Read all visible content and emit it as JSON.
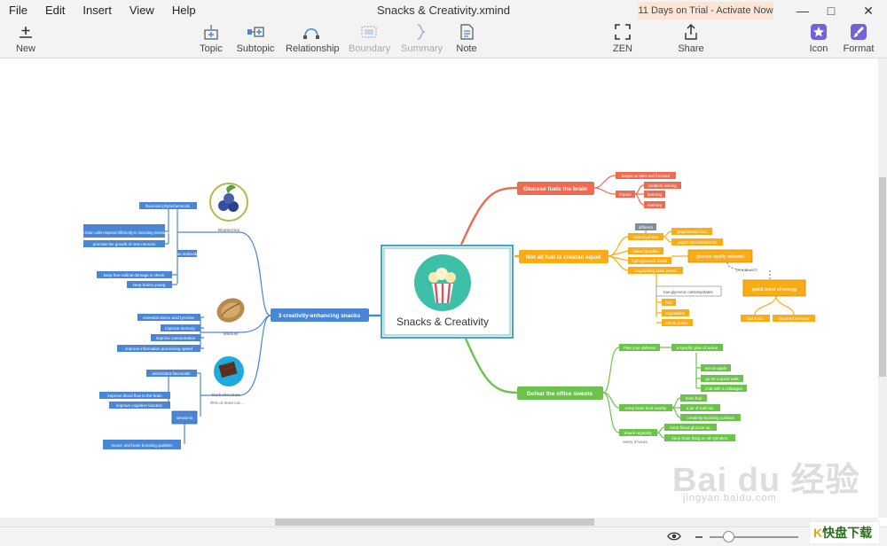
{
  "menu": [
    "File",
    "Edit",
    "Insert",
    "View",
    "Help"
  ],
  "document_title": "Snacks & Creativity.xmind",
  "trial_banner": "11 Days on Trial - Activate Now",
  "toolbar": {
    "new": "New",
    "topic": "Topic",
    "subtopic": "Subtopic",
    "relationship": "Relationship",
    "boundary": "Boundary",
    "summary": "Summary",
    "note": "Note",
    "zen": "ZEN",
    "share": "Share",
    "icon": "Icon",
    "format": "Format"
  },
  "colors": {
    "red": "#f06a52",
    "orange": "#fbab16",
    "green": "#6cc34c",
    "blue": "#4a86d6",
    "center_border": "#3fa9cb",
    "center_circle": "#3dbfa8"
  },
  "mindmap": {
    "central": "Snacks & Creativity",
    "branch_red": {
      "title": "Glucose fuels the brain",
      "n1": "keeps us alert and focused",
      "n2": "impact",
      "n3": "problem solving",
      "n4": "learning",
      "n5": "memory"
    },
    "branch_orange": {
      "title": "Not all fuel is created equal",
      "different": "different",
      "carbohydrates": "carbohydrates",
      "n1": "gingerbread man",
      "n2": "yogurt and blueberries",
      "n3": "baked goodies",
      "n4": "high-glycemic foods",
      "n5": "long-lasting brain power",
      "glucose_rapid": "glucose rapidly released",
      "provide_with": "provide with",
      "quick_burst": "quick burst of energy",
      "low_glycemic": "low-glycemic carbohydrates",
      "fruit": "fruit",
      "vegetables": "vegetables",
      "whole_grains": "whole grains",
      "fast_food": "fast food",
      "impaired_memory": "impaired memory"
    },
    "branch_green": {
      "title": "Defeat the office sweets",
      "plan": "Plan your defense",
      "plan_of_action": "a specific plan of action",
      "eat_apple": "eat an apple",
      "quick_walk": "go for a quick walk",
      "chat": "chat with a colleague",
      "keep_food": "Keep brain food nearby",
      "fresh_fruit": "fresh fruit",
      "trail_mix": "a jar of trail mix",
      "creativity_combos": "creativity-boosting combos",
      "snack_regularly": "Snack regularly",
      "every_3": "every 3 hours",
      "glucose_up": "keep blood glucose up",
      "brain_firing": "keep brain firing on all cylinders"
    },
    "branch_blue": {
      "title": "3 creativity-enhancing snacks",
      "blueberries": "Blueberries",
      "flavonoid": "flavonoid phytochemicals",
      "respond": "help brain cells respond efficiently to incoming messages",
      "neurons": "promote the growth of new neurons",
      "antioxidants": "act as antioxidants",
      "radical": "keep free-radical damage in check",
      "young": "keep brains young",
      "walnuts": "Walnuts",
      "amino": "essential amino acid tyrosine",
      "memory": "improve memory",
      "concentration": "improve concentration",
      "processing": "improve information processing speed",
      "dark_chocolate": "Dark chocolate",
      "cocoa": "70% or more coc...",
      "flavonols": "antioxidant flavonoids",
      "blood_flow": "improve blood flow to the brain",
      "cognitive": "improve cognitive function",
      "serotonin": "serotonin",
      "mood": "mood- and brain-boosting qualities"
    }
  },
  "watermark": "Bai du 经验",
  "watermark_url": "jingyan.baidu.com",
  "corner_logo": {
    "a": "K",
    "b": "快盘下载"
  }
}
